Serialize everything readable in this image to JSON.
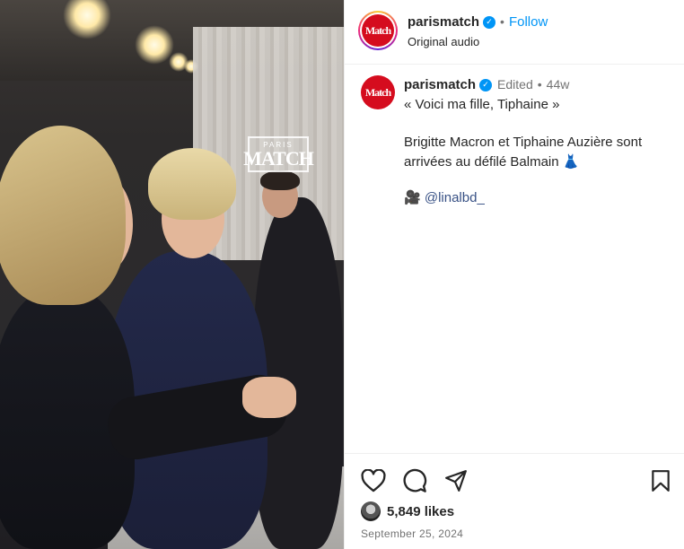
{
  "video": {
    "watermark_top": "PARIS",
    "watermark_main": "MATCH"
  },
  "header": {
    "avatar_logo": "Match",
    "username": "parismatch",
    "verified": "✓",
    "separator": "•",
    "follow_label": "Follow",
    "audio_label": "Original audio"
  },
  "caption": {
    "avatar_logo": "Match",
    "username": "parismatch",
    "verified": "✓",
    "edited_label": "Edited",
    "separator": "•",
    "time_ago": "44w",
    "quote_line": "« Voici ma fille, Tiphaine »",
    "body_line1": "Brigitte Macron et Tiphaine Auzière sont",
    "body_line2": "arrivées au défilé Balmain 👗",
    "credit_icon": "🎥",
    "credit_mention": "@linalbd_"
  },
  "actions": {
    "like_icon": "heart-icon",
    "comment_icon": "comment-icon",
    "share_icon": "share-icon",
    "save_icon": "bookmark-icon"
  },
  "stats": {
    "likes_label": "5,849 likes",
    "date": "September 25, 2024"
  },
  "colors": {
    "link": "#0095f6",
    "brand_red": "#d50c1e",
    "muted": "#737373"
  }
}
